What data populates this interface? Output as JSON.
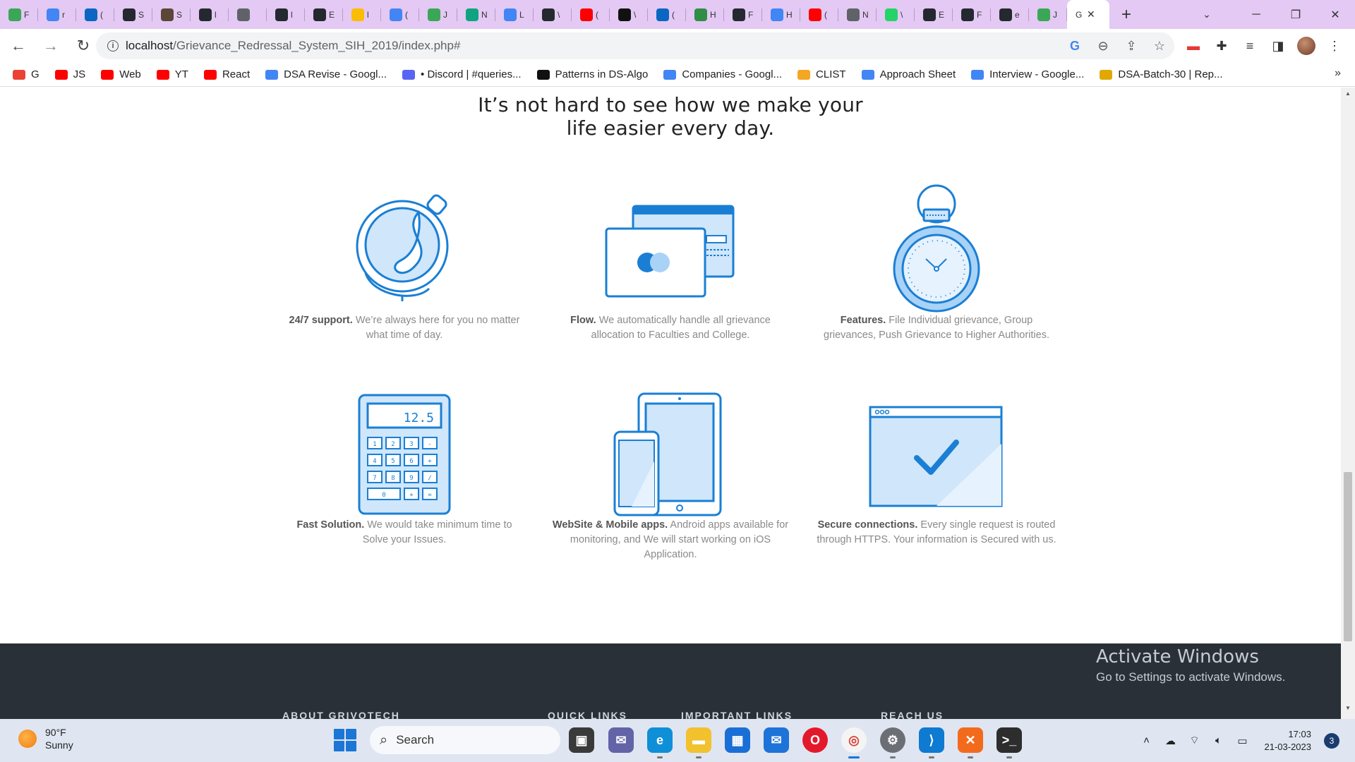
{
  "browser": {
    "tabs": [
      {
        "icon": "leaf-icon",
        "letter": "F",
        "color": "#3aa757"
      },
      {
        "icon": "google-icon",
        "letter": "r",
        "color": "#4285f4"
      },
      {
        "icon": "linkedin-icon",
        "letter": "(",
        "color": "#0a66c2"
      },
      {
        "icon": "github-icon",
        "letter": "S",
        "color": "#24292f"
      },
      {
        "icon": "codechef-icon",
        "letter": "S",
        "color": "#5b4638"
      },
      {
        "icon": "github-icon",
        "letter": "l",
        "color": "#24292f"
      },
      {
        "icon": "globe-icon",
        "letter": "",
        "color": "#5f6368"
      },
      {
        "icon": "github-icon",
        "letter": "l",
        "color": "#24292f"
      },
      {
        "icon": "github-icon",
        "letter": "E",
        "color": "#24292f"
      },
      {
        "icon": "drive-icon",
        "letter": "l",
        "color": "#fbbc04"
      },
      {
        "icon": "docs-icon",
        "letter": "(",
        "color": "#4285f4"
      },
      {
        "icon": "leaf-icon",
        "letter": "J",
        "color": "#3aa757"
      },
      {
        "icon": "chatgpt-icon",
        "letter": "N",
        "color": "#10a37f"
      },
      {
        "icon": "google-icon",
        "letter": "L",
        "color": "#4285f4"
      },
      {
        "icon": "github-icon",
        "letter": "\\",
        "color": "#24292f"
      },
      {
        "icon": "youtube-icon",
        "letter": "(",
        "color": "#ff0000"
      },
      {
        "icon": "w-icon",
        "letter": "\\",
        "color": "#111111"
      },
      {
        "icon": "linkedin-icon",
        "letter": "(",
        "color": "#0a66c2"
      },
      {
        "icon": "gfg-icon",
        "letter": "H",
        "color": "#2f8d46"
      },
      {
        "icon": "github-icon",
        "letter": "F",
        "color": "#24292f"
      },
      {
        "icon": "google-icon",
        "letter": "H",
        "color": "#4285f4"
      },
      {
        "icon": "youtube-icon",
        "letter": "(",
        "color": "#ff0000"
      },
      {
        "icon": "globe-icon",
        "letter": "N",
        "color": "#5f6368"
      },
      {
        "icon": "whatsapp-icon",
        "letter": "\\",
        "color": "#25d366"
      },
      {
        "icon": "github-icon",
        "letter": "E",
        "color": "#24292f"
      },
      {
        "icon": "github-icon",
        "letter": "F",
        "color": "#24292f"
      },
      {
        "icon": "github-icon",
        "letter": "e",
        "color": "#24292f"
      },
      {
        "icon": "leaf-icon",
        "letter": "J",
        "color": "#3aa757"
      }
    ],
    "active_tab": {
      "letter": "G",
      "close": "✕"
    },
    "new_tab": "+",
    "window_controls": {
      "minimize": "─",
      "maximize": "❐",
      "close": "✕"
    },
    "url_host": "localhost",
    "url_path": "/Grievance_Redressal_System_SIH_2019/index.php#",
    "bookmarks": [
      {
        "label": "G",
        "icon": "gmail-icon",
        "color": "#ea4335"
      },
      {
        "label": "JS",
        "icon": "youtube-icon",
        "color": "#ff0000"
      },
      {
        "label": "Web",
        "icon": "youtube-icon",
        "color": "#ff0000"
      },
      {
        "label": "YT",
        "icon": "youtube-icon",
        "color": "#ff0000"
      },
      {
        "label": "React",
        "icon": "youtube-icon",
        "color": "#ff0000"
      },
      {
        "label": "DSA Revise - Googl...",
        "icon": "docs-icon",
        "color": "#4285f4"
      },
      {
        "label": "• Discord | #queries...",
        "icon": "discord-icon",
        "color": "#5865f2"
      },
      {
        "label": "Patterns in DS-Algo",
        "icon": "notion-icon",
        "color": "#111111"
      },
      {
        "label": "Companies - Googl...",
        "icon": "docs-icon",
        "color": "#4285f4"
      },
      {
        "label": "CLIST",
        "icon": "clist-icon",
        "color": "#f5a623"
      },
      {
        "label": "Approach Sheet",
        "icon": "docs-icon",
        "color": "#4285f4"
      },
      {
        "label": "Interview - Google...",
        "icon": "docs-icon",
        "color": "#4285f4"
      },
      {
        "label": "DSA-Batch-30 | Rep...",
        "icon": "trophy-icon",
        "color": "#e0a800"
      }
    ],
    "bookmarks_more": "»"
  },
  "page": {
    "headline_line1": "It’s not hard to see how we make your",
    "headline_line2": "life easier every day.",
    "accent_color": "#1a7fd4",
    "features": [
      {
        "title": "24/7 support.",
        "text": "We’re always here for you no matter what time of day.",
        "icon": "globe-icon"
      },
      {
        "title": "Flow.",
        "text": "We automatically handle all grievance allocation to Faculties and College.",
        "icon": "credit-card-icon"
      },
      {
        "title": "Features.",
        "text": "File Individual grievance, Group grievances, Push Grievance to Higher Authorities.",
        "icon": "stopwatch-icon"
      },
      {
        "title": "Fast Solution.",
        "text": "We would take minimum time to Solve your Issues.",
        "icon": "calculator-icon"
      },
      {
        "title": "WebSite & Mobile apps.",
        "text": "Android apps available for monitoring, and We will start working on iOS Application.",
        "icon": "devices-icon"
      },
      {
        "title": "Secure connections.",
        "text": "Every single request is routed through HTTPS. Your information is Secured with us.",
        "icon": "browser-check-icon"
      }
    ],
    "calculator_display": "12.5",
    "calculator_keys": [
      "1",
      "2",
      "3",
      "-",
      "4",
      "5",
      "6",
      "+",
      "7",
      "8",
      "9",
      "/",
      "0",
      "+",
      "="
    ],
    "footer_headings": [
      "ABOUT GRIVOTECH",
      "QUICK LINKS",
      "IMPORTANT LINKS",
      "REACH US"
    ]
  },
  "watermark": {
    "line1": "Activate Windows",
    "line2": "Go to Settings to activate Windows."
  },
  "taskbar": {
    "temperature": "90°F",
    "condition": "Sunny",
    "search_label": "Search",
    "time": "17:03",
    "date": "21-03-2023",
    "notification_count": "3"
  }
}
